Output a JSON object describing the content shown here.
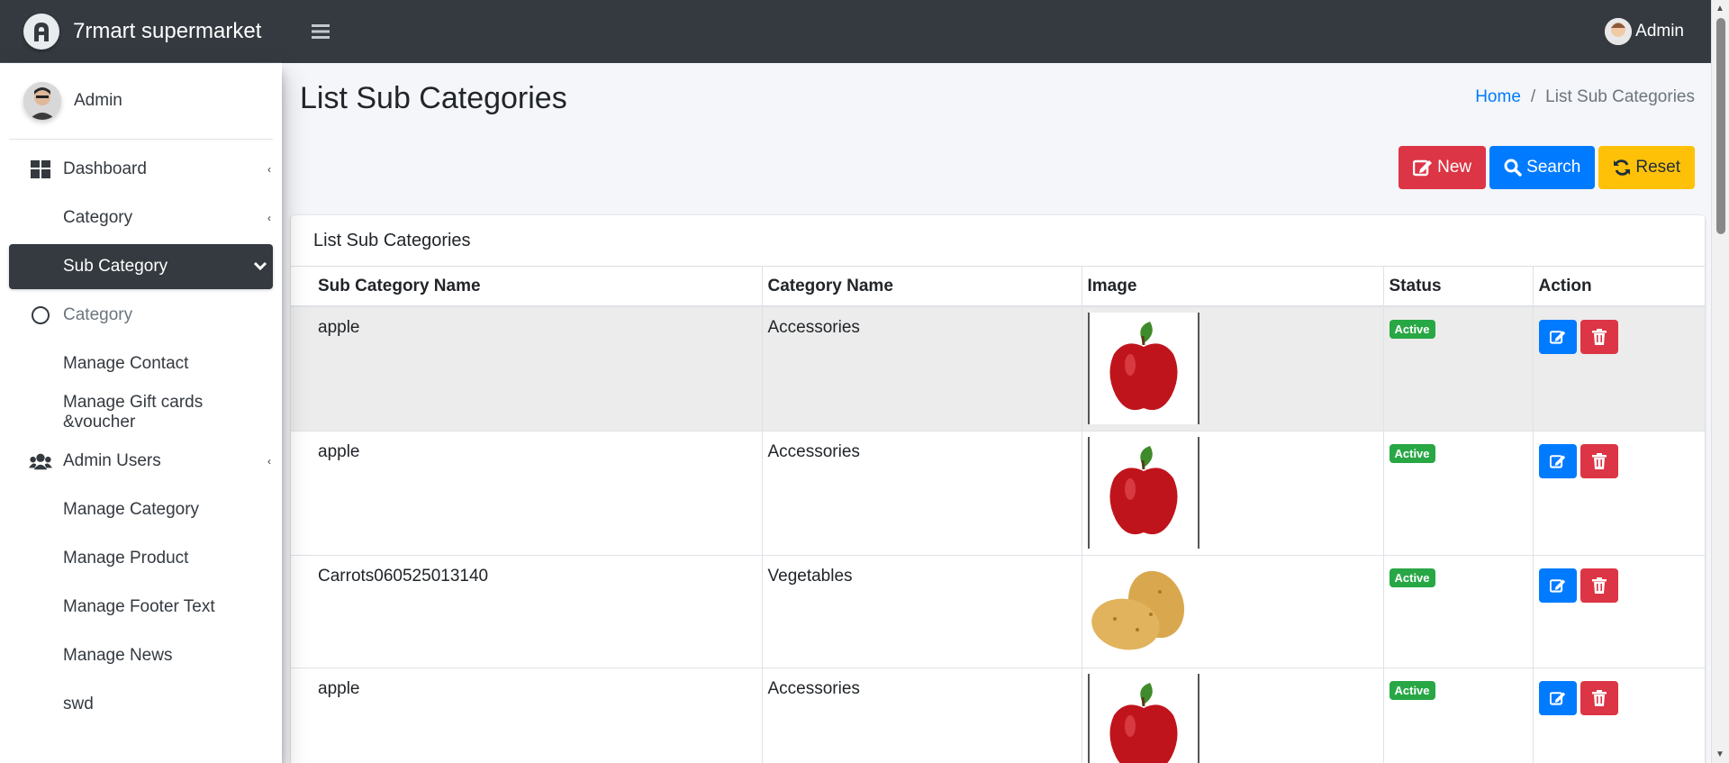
{
  "brand": {
    "name": "7rmart supermarket"
  },
  "sidebar": {
    "user_name": "Admin",
    "items": [
      {
        "label": "Dashboard",
        "icon": "dashboard-icon",
        "caret": true
      },
      {
        "label": "Category",
        "icon": "",
        "caret": true
      },
      {
        "label": "Sub Category",
        "icon": "",
        "caret": true,
        "active": true
      },
      {
        "label": "Category",
        "icon": "circle-icon",
        "muted": true
      },
      {
        "label": "Manage Contact",
        "icon": ""
      },
      {
        "label": "Manage Gift cards &voucher",
        "icon": ""
      },
      {
        "label": "Admin Users",
        "icon": "users-icon",
        "caret": true
      },
      {
        "label": "Manage Category",
        "icon": ""
      },
      {
        "label": "Manage Product",
        "icon": ""
      },
      {
        "label": "Manage Footer Text",
        "icon": ""
      },
      {
        "label": "Manage News",
        "icon": ""
      },
      {
        "label": "swd",
        "icon": ""
      }
    ]
  },
  "navbar": {
    "user_name": "Admin"
  },
  "page": {
    "title": "List Sub Categories",
    "breadcrumb": {
      "home": "Home",
      "current": "List Sub Categories"
    },
    "buttons": {
      "new": "New",
      "search": "Search",
      "reset": "Reset"
    }
  },
  "card": {
    "title": "List Sub Categories",
    "columns": [
      "Sub Category Name",
      "Category Name",
      "Image",
      "Status",
      "Action"
    ],
    "rows": [
      {
        "sub_category": "apple",
        "category": "Accessories",
        "image": "apple",
        "status": "Active"
      },
      {
        "sub_category": "apple",
        "category": "Accessories",
        "image": "apple",
        "status": "Active"
      },
      {
        "sub_category": "Carrots060525013140",
        "category": "Vegetables",
        "image": "potato",
        "status": "Active"
      },
      {
        "sub_category": "apple",
        "category": "Accessories",
        "image": "apple",
        "status": "Active"
      }
    ]
  },
  "colors": {
    "navbar": "#343a40",
    "primary": "#007bff",
    "danger": "#dc3545",
    "warning": "#ffc107",
    "success": "#28a745"
  }
}
